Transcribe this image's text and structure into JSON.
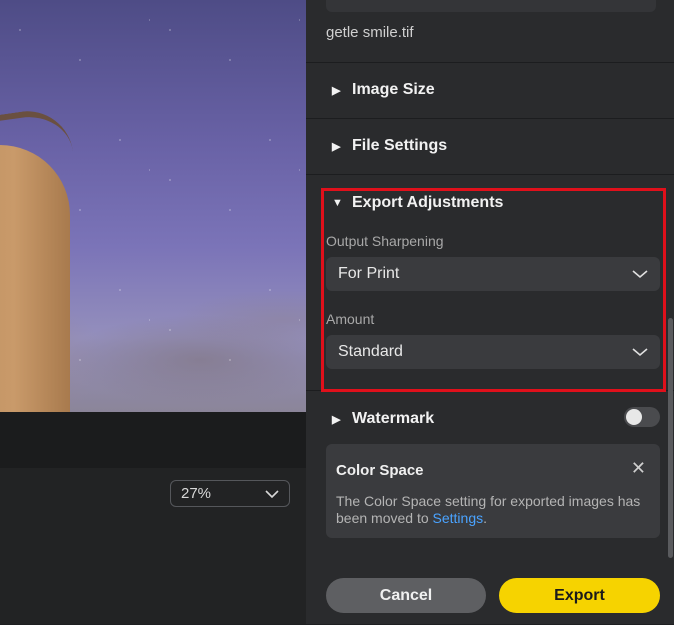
{
  "preview": {
    "zoom_value": "27%"
  },
  "panel": {
    "filename": "getle smile.tif",
    "sections": {
      "image_size": "Image Size",
      "file_settings": "File Settings",
      "export_adjustments": "Export Adjustments",
      "watermark": "Watermark"
    },
    "output_sharpening": {
      "label": "Output Sharpening",
      "value": "For Print"
    },
    "amount": {
      "label": "Amount",
      "value": "Standard"
    },
    "watermark_enabled": false,
    "notice": {
      "title": "Color Space",
      "body": "The Color Space setting for exported images has been moved to",
      "link": "Settings",
      "suffix": "."
    },
    "buttons": {
      "cancel": "Cancel",
      "export": "Export"
    }
  },
  "colors": {
    "accent": "#f6d300",
    "highlight": "#e0101b",
    "link": "#4aa3ff"
  }
}
